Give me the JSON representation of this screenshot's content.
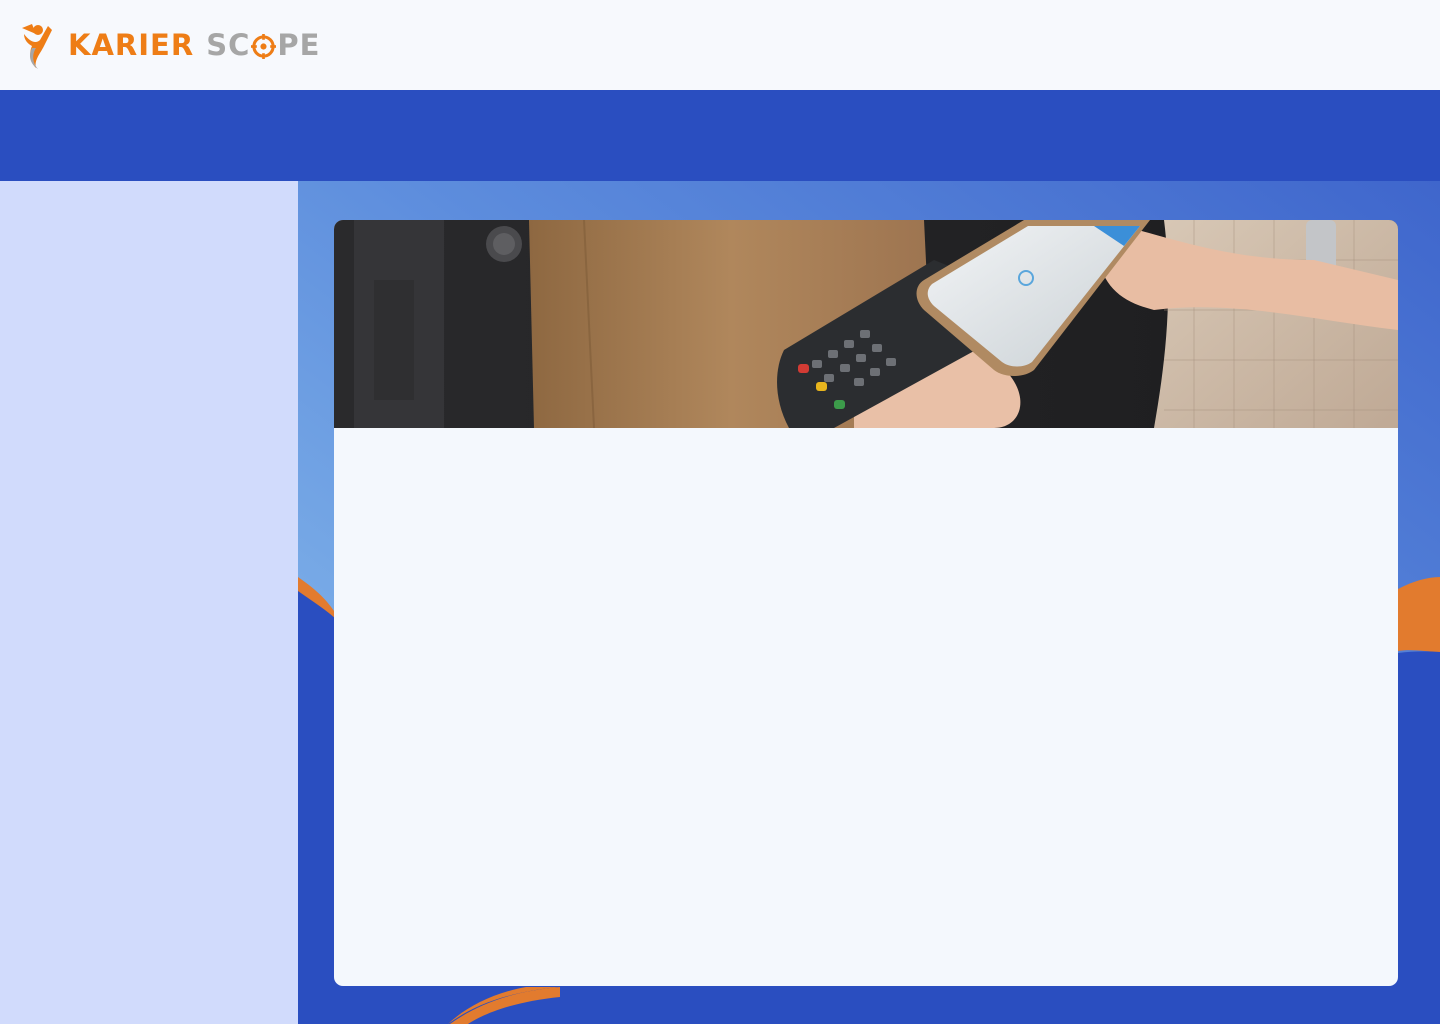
{
  "header": {
    "brand_primary": "KARIER",
    "brand_secondary_pre": "SC",
    "brand_secondary_post": "PE",
    "logo_icon": "person-arrow-icon"
  },
  "colors": {
    "brand_orange": "#ee7d16",
    "brand_gray": "#a6a6a6",
    "band_blue": "#2a4ec0",
    "sidebar": "#d1dbfc",
    "card": "#f4f8fd"
  },
  "card": {
    "hero_image": "contactless-payment-photo"
  }
}
